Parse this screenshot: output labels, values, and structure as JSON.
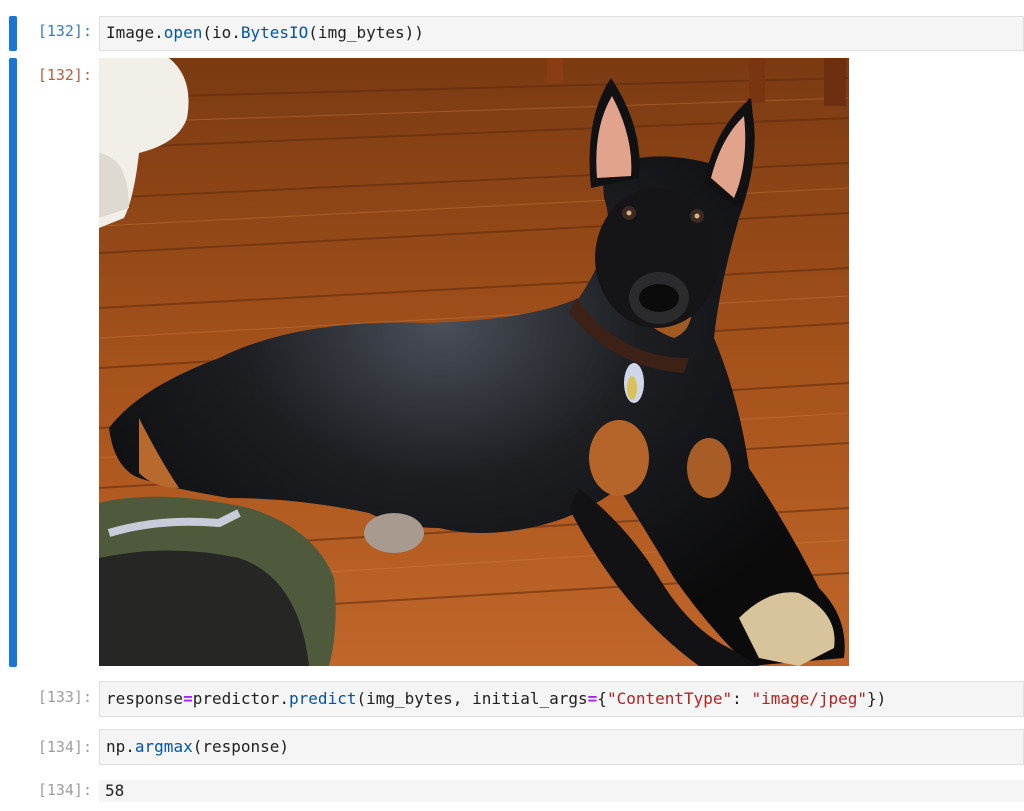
{
  "cells": [
    {
      "in_prompt": "[132]:",
      "code": [
        {
          "t": "Image.",
          "c": "plain"
        },
        {
          "t": "open",
          "c": "fn"
        },
        {
          "t": "(io.",
          "c": "plain"
        },
        {
          "t": "BytesIO",
          "c": "fn"
        },
        {
          "t": "(img_bytes))",
          "c": "plain"
        }
      ],
      "out_prompt": "[132]:",
      "output_type": "image",
      "output_image": {
        "subject": "black-and-tan doberman lying on a hardwood floor"
      }
    },
    {
      "in_prompt": "[133]:",
      "code": [
        {
          "t": "response",
          "c": "plain"
        },
        {
          "t": "=",
          "c": "op"
        },
        {
          "t": "predictor.",
          "c": "plain"
        },
        {
          "t": "predict",
          "c": "fn"
        },
        {
          "t": "(img_bytes, initial_args",
          "c": "plain"
        },
        {
          "t": "=",
          "c": "op"
        },
        {
          "t": "{",
          "c": "plain"
        },
        {
          "t": "\"ContentType\"",
          "c": "str"
        },
        {
          "t": ": ",
          "c": "plain"
        },
        {
          "t": "\"image/jpeg\"",
          "c": "str"
        },
        {
          "t": "})",
          "c": "plain"
        }
      ]
    },
    {
      "in_prompt": "[134]:",
      "code": [
        {
          "t": "np.",
          "c": "plain"
        },
        {
          "t": "argmax",
          "c": "fn"
        },
        {
          "t": "(response)",
          "c": "plain"
        }
      ],
      "out_prompt": "[134]:",
      "output_type": "text",
      "output_text": "58"
    }
  ],
  "colors": {
    "active_collapser": "#1976d2",
    "in_prompt": "#307fc1",
    "out_prompt": "#bf5b3d",
    "inactive_prompt": "#9e9e9e",
    "editor_bg": "#f5f5f5"
  }
}
